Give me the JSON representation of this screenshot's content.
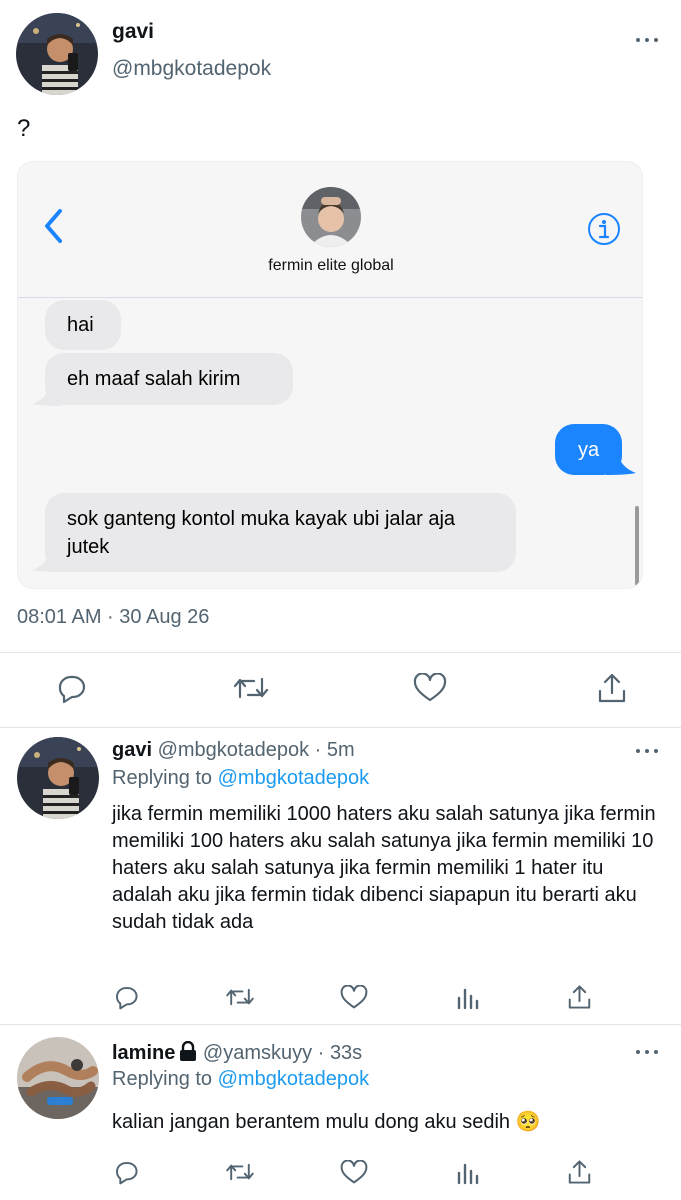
{
  "main_tweet": {
    "author_name": "gavi",
    "author_handle": "@mbgkotadepok",
    "text": "?",
    "timestamp": "08:01 AM · 30 Aug 26"
  },
  "chat": {
    "contact_name": "fermin elite global",
    "messages": [
      {
        "from": "them",
        "text": "hai"
      },
      {
        "from": "them",
        "text": "eh maaf salah kirim"
      },
      {
        "from": "me",
        "text": "ya"
      },
      {
        "from": "them",
        "text": "sok ganteng kontol muka kayak ubi jalar aja jutek"
      }
    ]
  },
  "main_actions": [
    "reply-icon",
    "retweet-icon",
    "like-icon",
    "share-icon"
  ],
  "replies": [
    {
      "author_name": "gavi",
      "author_handle": "@mbgkotadepok",
      "dot": "·",
      "time": "5m",
      "replying_label": "Replying to",
      "replying_to": "@mbgkotadepok",
      "text": "jika fermin memiliki 1000 haters aku salah satunya jika fermin memiliki 100 haters aku salah satunya jika fermin memiliki 10 haters aku salah satunya jika fermin memiliki 1 hater itu adalah aku jika fermin tidak dibenci siapapun itu berarti aku sudah tidak ada"
    },
    {
      "author_name": "lamine",
      "author_handle": "@yamskuyy",
      "dot": "·",
      "time": "33s",
      "replying_label": "Replying to",
      "replying_to": "@mbgkotadepok",
      "text": "kalian jangan berantem mulu dong aku sedih 🥺"
    }
  ],
  "colors": {
    "link": "#1d9bf0",
    "secondary_text": "#536471",
    "imessage_blue": "#1b84ff",
    "imessage_gray": "#e9e9eb"
  }
}
